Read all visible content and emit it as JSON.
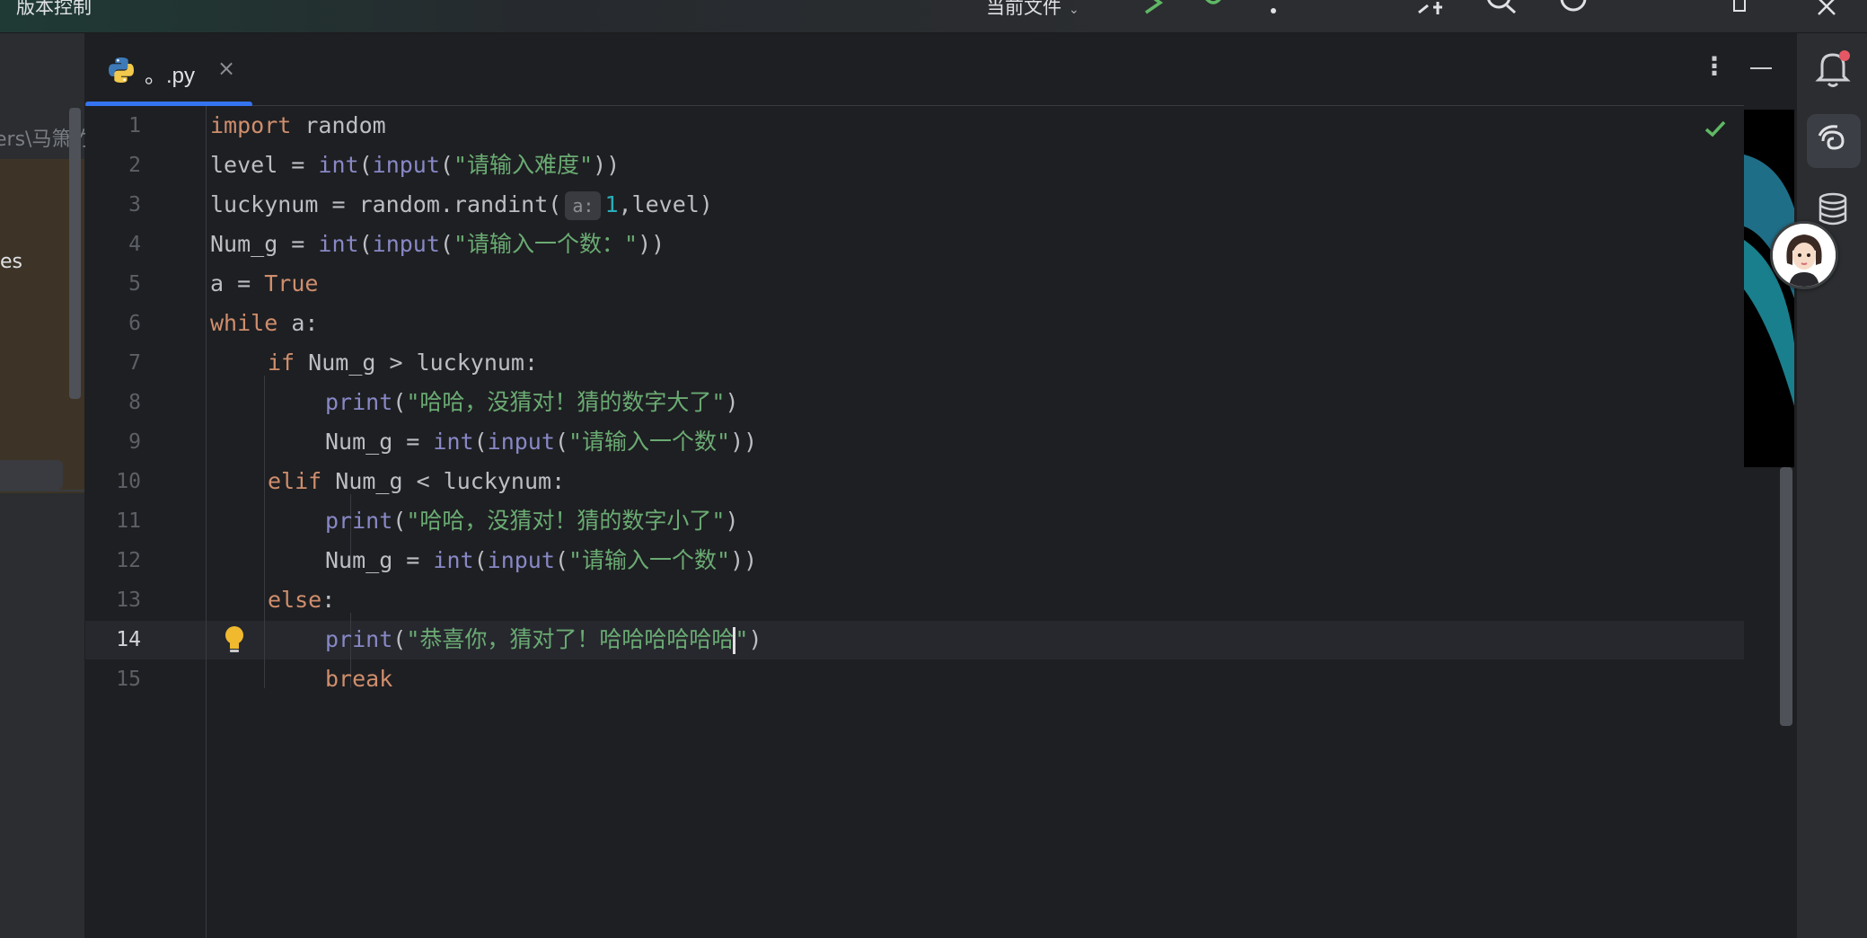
{
  "titlebar": {
    "vcs_label": "版本控制",
    "run_config": "当前文件",
    "accent": "#3574f0"
  },
  "project": {
    "path_fragment": "ers\\马箫竹",
    "item_fragment": "es"
  },
  "tab": {
    "name": "。.py",
    "close": "×"
  },
  "editor": {
    "current_line": 14,
    "line_numbers": [
      "1",
      "2",
      "3",
      "4",
      "5",
      "6",
      "7",
      "8",
      "9",
      "10",
      "11",
      "12",
      "13",
      "14",
      "15"
    ],
    "lines": {
      "l1_kw": "import",
      "l1_rest": " random",
      "l2_a": "level = ",
      "l2_int": "int",
      "l2_p": "(",
      "l2_input": "input",
      "l2_q": "(",
      "l2_str": "\"请输入难度\"",
      "l2_end": "))",
      "l3_a": "luckynum = random.randint(",
      "l3_hint": "a:",
      "l3_num": "1",
      "l3_end": ",level)",
      "l4_a": "Num_g = ",
      "l4_int": "int",
      "l4_p": "(",
      "l4_input": "input",
      "l4_q": "(",
      "l4_str": "\"请输入一个数：\"",
      "l4_end": "))",
      "l5_a": "a = ",
      "l5_kw": "True",
      "l6_kw": "while",
      "l6_rest": " a:",
      "l7_kw": "if",
      "l7_rest": " Num_g > luckynum:",
      "l8_fn": "print",
      "l8_p": "(",
      "l8_str": "\"哈哈，没猜对！猜的数字大了\"",
      "l8_end": ")",
      "l9_a": "Num_g = ",
      "l9_int": "int",
      "l9_p": "(",
      "l9_input": "input",
      "l9_q": "(",
      "l9_str": "\"请输入一个数\"",
      "l9_end": "))",
      "l10_kw": "elif",
      "l10_rest": " Num_g < luckynum:",
      "l11_fn": "print",
      "l11_p": "(",
      "l11_str": "\"哈哈，没猜对！猜的数字小了\"",
      "l11_end": ")",
      "l12_a": "Num_g = ",
      "l12_int": "int",
      "l12_p": "(",
      "l12_input": "input",
      "l12_q": "(",
      "l12_str": "\"请输入一个数\"",
      "l12_end": "))",
      "l13_kw": "else",
      "l13_rest": ":",
      "l14_fn": "print",
      "l14_p": "(",
      "l14_str_a": "\"恭喜你，猜对了！哈哈哈哈哈哈",
      "l14_str_b": "\"",
      "l14_end": ")",
      "l15_kw": "break"
    },
    "colors": {
      "keyword": "#cf8e6d",
      "builtin": "#8888c6",
      "string": "#6aab73",
      "number": "#2aacb8",
      "text": "#bcbec4"
    }
  },
  "icons": {
    "python_file": "python-file-icon",
    "bulb": "intention-bulb-icon",
    "check": "inspection-ok-icon",
    "notifications": "notification-bell-icon",
    "ai": "ai-assistant-icon",
    "database": "database-icon"
  }
}
